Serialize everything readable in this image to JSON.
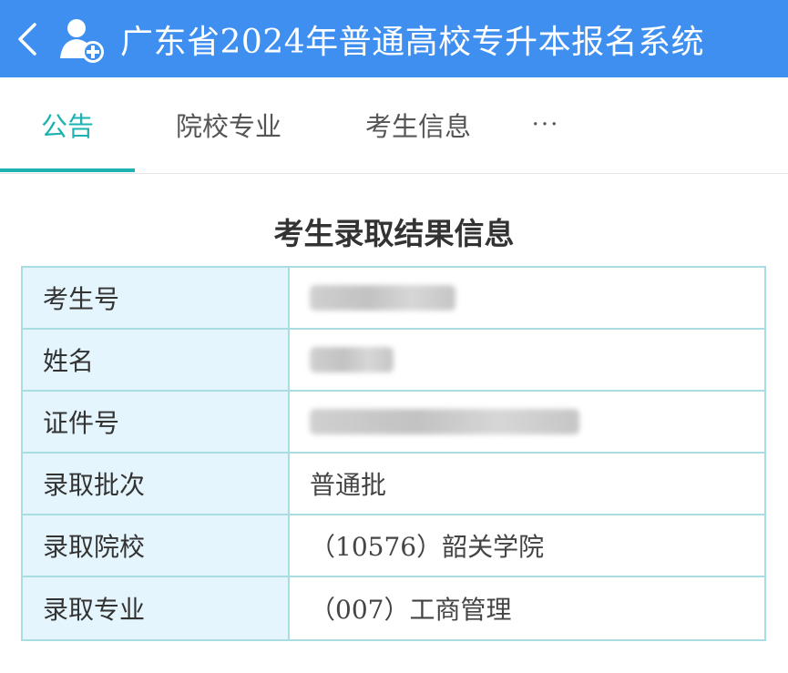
{
  "header": {
    "title": "广东省2024年普通高校专升本报名系统",
    "bg_color": "#3e8ff0"
  },
  "tabs": [
    {
      "label": "公告",
      "active": true
    },
    {
      "label": "院校专业",
      "active": false
    },
    {
      "label": "考生信息",
      "active": false
    },
    {
      "label": "···",
      "active": false
    }
  ],
  "accent_color": "#1cb3b2",
  "result": {
    "title": "考生录取结果信息",
    "rows": [
      {
        "label": "考生号",
        "value": ""
      },
      {
        "label": "姓名",
        "value": ""
      },
      {
        "label": "证件号",
        "value": ""
      },
      {
        "label": "录取批次",
        "value": "普通批"
      },
      {
        "label": "录取院校",
        "value": "（10576）韶关学院"
      },
      {
        "label": "录取专业",
        "value": "（007）工商管理"
      }
    ]
  }
}
